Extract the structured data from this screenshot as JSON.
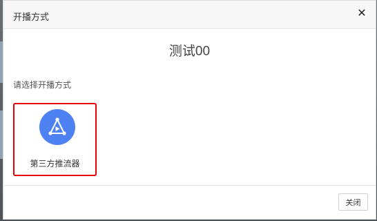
{
  "dialog": {
    "title": "开播方式",
    "close_icon": "close-icon"
  },
  "stream": {
    "name": "测试00"
  },
  "prompt": "请选择开播方式",
  "methods": [
    {
      "label": "第三方推流器",
      "icon": "push-stream-icon",
      "selected": true,
      "icon_color": "#4e82f3",
      "highlight_color": "#e60000"
    }
  ],
  "footer": {
    "close_label": "关闭"
  }
}
